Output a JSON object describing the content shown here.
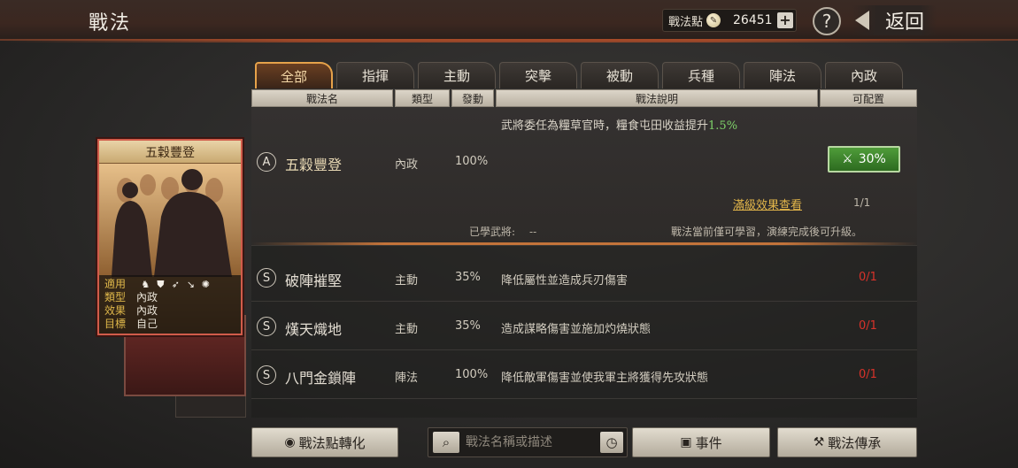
{
  "header": {
    "title": "戰法",
    "points_label": "戰法點",
    "points_value": "26451",
    "help_label": "?",
    "back_label": "返回"
  },
  "tabs": [
    {
      "label": "全部",
      "active": true
    },
    {
      "label": "指揮"
    },
    {
      "label": "主動"
    },
    {
      "label": "突擊"
    },
    {
      "label": "被動"
    },
    {
      "label": "兵種"
    },
    {
      "label": "陣法"
    },
    {
      "label": "內政"
    }
  ],
  "columns": {
    "name": "戰法名",
    "type": "類型",
    "rate": "發動",
    "desc": "戰法說明",
    "slots": "可配置"
  },
  "selected": {
    "grade": "A",
    "name": "五穀豐登",
    "type": "內政",
    "rate": "100%",
    "desc_prefix": "武將委任為糧草官時，糧食屯田收益提升",
    "desc_highlight": "1.5%",
    "upgrade_label": "30%",
    "max_link": "滿級效果查看",
    "progress": "1/1",
    "learned_label": "已學武將:",
    "learned_value": "--",
    "note": "戰法當前僅可學習，演練完成後可升級。"
  },
  "rows": [
    {
      "grade": "S",
      "name": "破陣摧堅",
      "type": "主動",
      "rate": "35%",
      "desc": "降低屬性並造成兵刃傷害",
      "slots": "0/1"
    },
    {
      "grade": "S",
      "name": "熯天熾地",
      "type": "主動",
      "rate": "35%",
      "desc": "造成謀略傷害並施加灼燒狀態",
      "slots": "0/1"
    },
    {
      "grade": "S",
      "name": "八門金鎖陣",
      "type": "陣法",
      "rate": "100%",
      "desc": "降低敵軍傷害並使我軍主將獲得先攻狀態",
      "slots": "0/1"
    }
  ],
  "card": {
    "title": "五穀豐登",
    "labels": {
      "apply": "適用",
      "type": "類型",
      "effect": "效果",
      "target": "目標"
    },
    "type_value": "內政",
    "effect_value": "內政",
    "target_value": "自己",
    "troop_icons": [
      "cavalry-icon",
      "shield-icon",
      "bow-icon",
      "spear-icon",
      "chariot-icon"
    ]
  },
  "bottom": {
    "convert_label": "戰法點轉化",
    "search_placeholder": "戰法名稱或描述",
    "event_label": "事件",
    "inherit_label": "戰法傳承"
  },
  "colors": {
    "accent": "#e6a24a",
    "highlight_green": "#7fd36a",
    "slots_red": "#d8322a",
    "card_border": "#d15c4a"
  }
}
